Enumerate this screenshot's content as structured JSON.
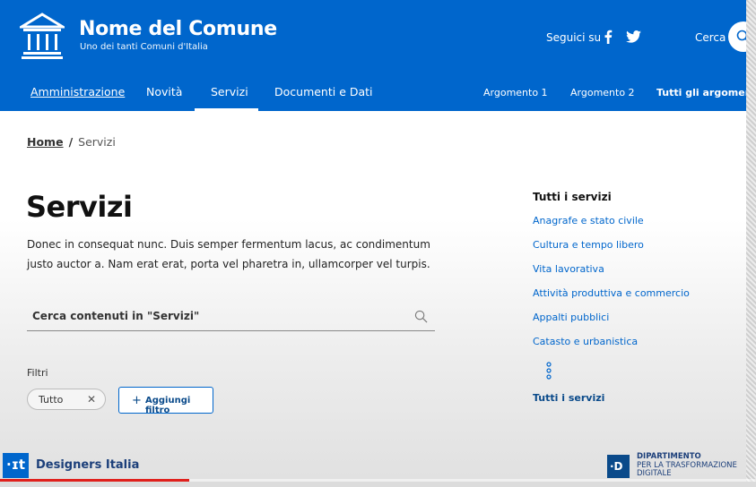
{
  "header": {
    "title": "Nome del Comune",
    "subtitle": "Uno dei tanti Comuni d'Italia",
    "follow_label": "Seguici su",
    "search_label": "Cerca",
    "icons": [
      "building-logo-icon",
      "facebook-icon",
      "twitter-icon",
      "search-icon"
    ]
  },
  "nav": {
    "left": [
      "Amministrazione",
      "Novità",
      "Servizi",
      "Documenti e Dati"
    ],
    "active": "Servizi",
    "right": [
      "Argomento 1",
      "Argomento 2",
      "Tutti gli argomenti..."
    ]
  },
  "breadcrumb": {
    "home": "Home",
    "separator": "/",
    "current": "Servizi"
  },
  "main": {
    "title": "Servizi",
    "description": "Donec in consequat nunc. Duis semper fermentum lacus, ac condimentum justo auctor a. Nam erat erat, porta vel pharetra in, ullamcorper vel turpis.",
    "search_placeholder": "Cerca contenuti in \"Servizi\"",
    "filters_label": "Filtri",
    "chip_label": "Tutto",
    "chip_close": "✕",
    "add_filter_label": "Aggiungi filtro",
    "add_filter_plus": "+"
  },
  "sidebar": {
    "title": "Tutti i servizi",
    "links": [
      "Anagrafe e stato civile",
      "Cultura e tempo libero",
      "Vita lavorativa",
      "Attività produttiva e commercio",
      "Appalti pubblici",
      "Catasto e urbanistica"
    ],
    "all_link": "Tutti i servizi"
  },
  "footer": {
    "designers_mark": "·ɪt",
    "designers_label": "Designers Italia",
    "dip_mark": "·D",
    "dip_line1": "DIPARTIMENTO",
    "dip_line2": "PER LA TRASFORMAZIONE",
    "dip_line3": "DIGITALE"
  },
  "video_progress": 0.25,
  "colors": {
    "primary": "#0066cc",
    "progress": "#e0201c",
    "dark_blue": "#0a4a8a"
  }
}
